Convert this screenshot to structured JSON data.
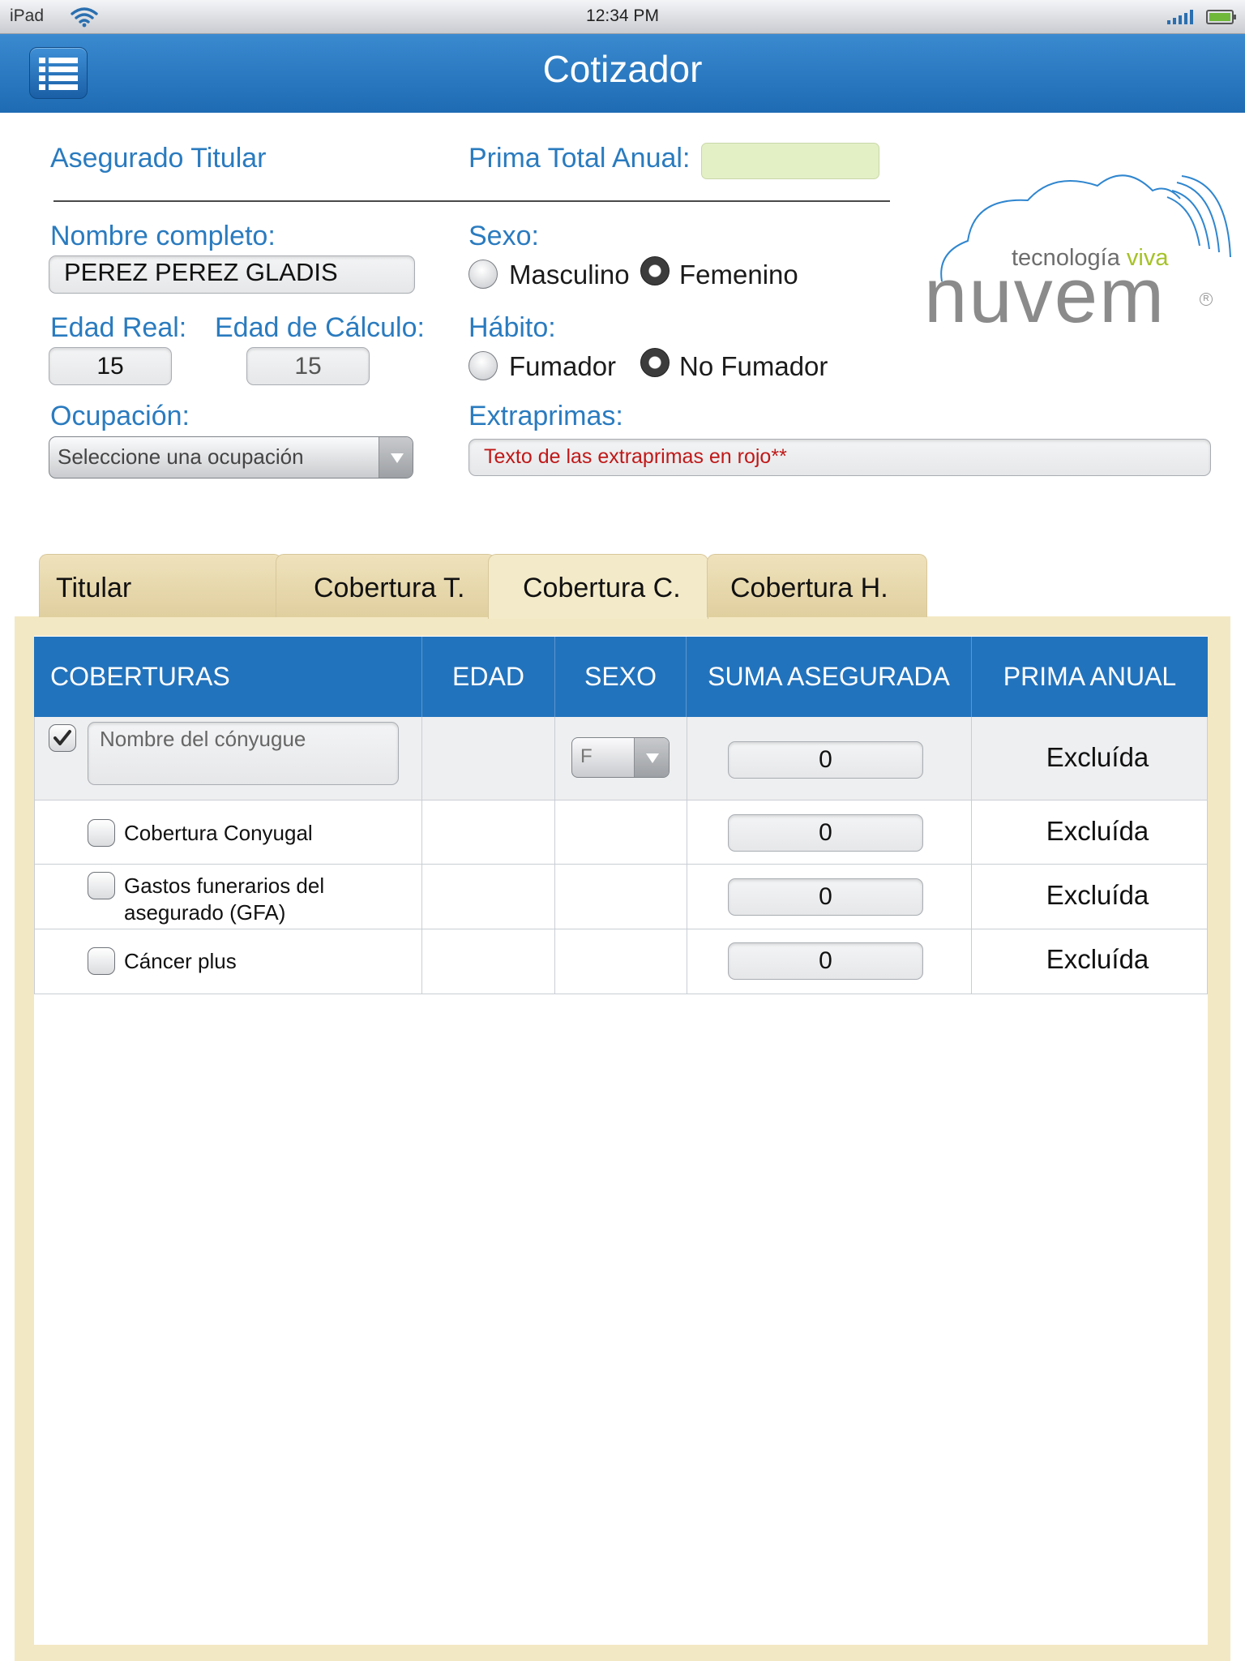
{
  "status_bar": {
    "device": "iPad",
    "time": "12:34 PM"
  },
  "nav": {
    "title": "Cotizador"
  },
  "header": {
    "asegurado_label": "Asegurado Titular",
    "prima_label": "Prima Total Anual:",
    "prima_value": ""
  },
  "form": {
    "nombre_label": "Nombre completo:",
    "nombre_value": "PEREZ PEREZ GLADIS",
    "edad_real_label": "Edad Real:",
    "edad_real_value": "15",
    "edad_calc_label": "Edad de Cálculo:",
    "edad_calc_value": "15",
    "ocupacion_label": "Ocupación:",
    "ocupacion_value": "Seleccione una ocupación",
    "sexo_label": "Sexo:",
    "sexo_options": [
      "Masculino",
      "Femenino"
    ],
    "sexo_selected": "Femenino",
    "habito_label": "Hábito:",
    "habito_options": [
      "Fumador",
      "No Fumador"
    ],
    "habito_selected": "No Fumador",
    "extraprimas_label": "Extraprimas:",
    "extraprimas_value": "Texto de las extraprimas en rojo**"
  },
  "logo": {
    "tagline_1": "tecnología",
    "tagline_2": "viva",
    "brand": "nuvem",
    "registered": "R"
  },
  "tabs": [
    {
      "label": "Titular",
      "active": false
    },
    {
      "label": "Cobertura T.",
      "active": false
    },
    {
      "label": "Cobertura C.",
      "active": true
    },
    {
      "label": "Cobertura H.",
      "active": false
    }
  ],
  "table": {
    "headers": [
      "COBERTURAS",
      "EDAD",
      "SEXO",
      "SUMA ASEGURADA",
      "PRIMA ANUAL"
    ],
    "spouse_row": {
      "checked": true,
      "name_placeholder": "Nombre del cónyugue",
      "edad": "",
      "sexo": "F",
      "suma": "0",
      "prima": "Excluída"
    },
    "rows": [
      {
        "label_1": "Cobertura Conyugal",
        "label_2": "",
        "checked": false,
        "suma": "0",
        "prima": "Excluída"
      },
      {
        "label_1": "Gastos funerarios del",
        "label_2": "asegurado (GFA)",
        "checked": false,
        "suma": "0",
        "prima": "Excluída"
      },
      {
        "label_1": "Cáncer plus",
        "label_2": "",
        "checked": false,
        "suma": "0",
        "prima": "Excluída"
      }
    ]
  },
  "colors": {
    "accent": "#2273bd",
    "label": "#2a7bbf",
    "panel": "#f3e8c4",
    "prima_field": "#e3f0c6",
    "extraprimas_text": "#c01818"
  },
  "icons": [
    "menu-list-icon",
    "wifi-icon",
    "signal-icon",
    "battery-icon",
    "chevron-down-icon",
    "checkmark-icon"
  ]
}
